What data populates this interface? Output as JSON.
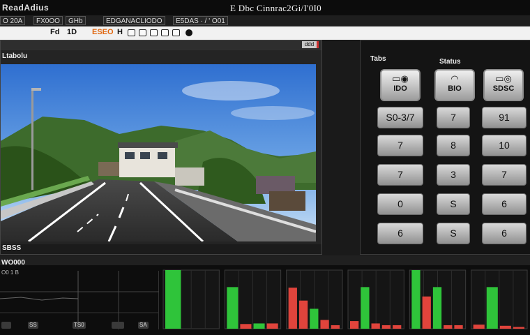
{
  "app": {
    "name": "ReadAdius",
    "window_title": "E Dbc Cinnraс2Gi/I'0I0"
  },
  "menu": {
    "items": [
      {
        "label": "O 20A"
      },
      {
        "label": "FX0OO"
      },
      {
        "label": "GHb"
      },
      {
        "label": "EDGANACLIODO"
      },
      {
        "label": "E5DAS · / ' O01"
      }
    ]
  },
  "toolbar": {
    "texts": [
      {
        "label": "Fd"
      },
      {
        "label": "1D"
      },
      {
        "label": "ESEO"
      },
      {
        "label": "H"
      }
    ],
    "button_icons": [
      "square-icon",
      "square-icon",
      "square-icon",
      "square-icon",
      "square-icon",
      "record-dot-icon",
      "record-dot-icon",
      "record-dot-icon"
    ]
  },
  "video_panel": {
    "label": "Ltabolu",
    "close_label": "ddd",
    "footer_label": "SBSS"
  },
  "keypad_panel": {
    "tabs_label": "Tabs",
    "status_label": "Status",
    "mode_buttons": [
      {
        "icon": "tape-icon",
        "label": "IDO"
      },
      {
        "icon": "wifi-icon",
        "label": "BIO"
      },
      {
        "icon": "dial-icon",
        "label": "SDSC"
      }
    ],
    "keys": [
      [
        "S0-3/7",
        "7",
        "91"
      ],
      [
        "7",
        "8",
        "10"
      ],
      [
        "7",
        "3",
        "7"
      ],
      [
        "0",
        "S",
        "6"
      ],
      [
        "6",
        "S",
        "6"
      ]
    ]
  },
  "bottom_panel": {
    "label": "WO000",
    "sub_label": "O0 1 B",
    "status_chips": [
      "",
      "SS",
      "TS0",
      "",
      "SA"
    ]
  },
  "colors": {
    "accent_green": "#2fc43a",
    "accent_red": "#e0443c",
    "toolbar_orange": "#e0660e",
    "sky": "#3b7fd6",
    "foliage": "#2f5a1e"
  },
  "chart_data": {
    "type": "bar",
    "groups": [
      {
        "values": [
          100,
          0,
          0
        ]
      },
      {
        "values": [
          71,
          8,
          9,
          9
        ]
      },
      {
        "values": [
          70,
          48,
          34,
          15,
          6
        ]
      },
      {
        "values": [
          13,
          71,
          9,
          6,
          6
        ]
      },
      {
        "values": [
          100,
          55,
          71,
          6,
          6
        ]
      },
      {
        "values": [
          7,
          71,
          5,
          3
        ]
      }
    ],
    "group_colors": [
      [
        "green"
      ],
      [
        "green",
        "red",
        "green",
        "red"
      ],
      [
        "red",
        "red",
        "green",
        "red",
        "red"
      ],
      [
        "red",
        "green",
        "red",
        "red",
        "red"
      ],
      [
        "green",
        "red",
        "green",
        "red",
        "red"
      ],
      [
        "red",
        "green",
        "red",
        "red"
      ]
    ],
    "ylim": [
      0,
      100
    ]
  }
}
